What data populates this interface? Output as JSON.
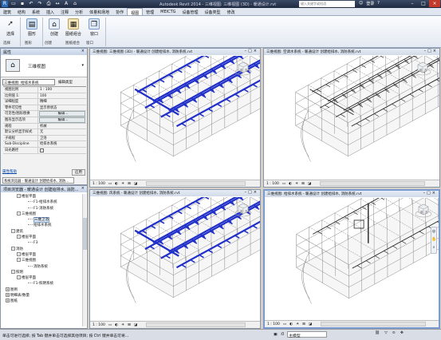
{
  "titlebar": {
    "title": "Autodesk Revit 2014 - 三维视图: 三维视图 (3D) - 暖通设计.rvt",
    "search_placeholder": "键入关键字或短语",
    "user": "登录",
    "help": "?"
  },
  "ribbon_tabs": [
    "建筑",
    "结构",
    "系统",
    "插入",
    "注释",
    "分析",
    "体量和场地",
    "协作",
    "视图",
    "管理",
    "MEICTG",
    "设备管理",
    "设备类型",
    "修改"
  ],
  "active_tab": "视图",
  "ribbon": {
    "buttons": [
      {
        "label": "选择",
        "icon": "select-icon"
      },
      {
        "label": "图形",
        "icon": "graphics-icon"
      },
      {
        "label": "创建",
        "icon": "create-view-icon"
      },
      {
        "label": "图纸组合",
        "icon": "sheet-composition-icon"
      },
      {
        "label": "窗口",
        "icon": "windows-icon"
      }
    ],
    "groups": [
      "选择",
      "图形",
      "创建",
      "图纸组合",
      "窗口"
    ]
  },
  "properties": {
    "title": "属性",
    "type_name": "三维视图",
    "selector": "三维视图: 给排水系统",
    "edit_type": "编辑类型",
    "rows": [
      {
        "k": "视图比例",
        "v": "1 : 100"
      },
      {
        "k": "比例值 1:",
        "v": "100"
      },
      {
        "k": "详细程度",
        "v": "精细"
      },
      {
        "k": "零件可见性",
        "v": "显示原状态"
      },
      {
        "k": "可见性/图形替换",
        "v": "编辑...",
        "btn": true
      },
      {
        "k": "图形显示选项",
        "v": "编辑...",
        "btn": true
      },
      {
        "k": "规程",
        "v": "机械"
      },
      {
        "k": "默认分析显示样式",
        "v": "无"
      },
      {
        "k": "子规程",
        "v": "卫浴"
      },
      {
        "k": "Sub-Discipline",
        "v": "给排水系统"
      },
      {
        "k": "日光路径",
        "v": ""
      }
    ],
    "help_link": "属性帮助",
    "apply": "应用",
    "tab_label": "系统浏览器 - 暖通设计 创建给排水, 消防..."
  },
  "browser": {
    "title": "项目浏览器 - 暖通设计 创建给排水, 消防...",
    "nodes": [
      {
        "label": "楼层平面",
        "depth": 2,
        "box": "-"
      },
      {
        "label": "F1-给排水系统",
        "depth": 4
      },
      {
        "label": "F1-消防系统",
        "depth": 4
      },
      {
        "label": "三维视图",
        "depth": 2,
        "box": "-"
      },
      {
        "label": "三维卫浴",
        "depth": 4,
        "selected": true
      },
      {
        "label": "给排水系统",
        "depth": 4
      },
      {
        "label": "建筑",
        "depth": 1,
        "box": "-"
      },
      {
        "label": "楼层平面",
        "depth": 2,
        "box": "-"
      },
      {
        "label": "F3",
        "depth": 4
      },
      {
        "label": "消防",
        "depth": 1,
        "box": "-"
      },
      {
        "label": "楼层平面",
        "depth": 2,
        "box": "-"
      },
      {
        "label": "三维视图",
        "depth": 2,
        "box": "-"
      },
      {
        "label": "消防系统",
        "depth": 4
      },
      {
        "label": "照明",
        "depth": 1,
        "box": "-"
      },
      {
        "label": "楼层平面",
        "depth": 2,
        "box": "-"
      },
      {
        "label": "F1-照明系统",
        "depth": 4
      },
      {
        "label": "图例",
        "depth": 0,
        "box": "+"
      },
      {
        "label": "明细表/数量",
        "depth": 0,
        "box": "+"
      },
      {
        "label": "图纸",
        "depth": 0,
        "box": "+"
      }
    ]
  },
  "views": [
    {
      "title": "三维视图: 三维视图 (3D) - 暖通设计 创建给排水, 消防系统.rvt",
      "scale": "1 : 100",
      "pipe_color": "#2030c8",
      "style": "blue"
    },
    {
      "title": "三维视图: 空调水系统 - 暖通设计 创建给排水, 消防系统.rvt",
      "scale": "1 : 100",
      "pipe_color": "#222222",
      "style": "black"
    },
    {
      "title": "三维视图: 风系统 - 暖通设计 创建给排水, 消防系统.rvt",
      "scale": "1 : 100",
      "pipe_color": "#2030c8",
      "style": "blue"
    },
    {
      "title": "三维视图: 给排水系统 - 暖通设计 创建给排水, 消防系统.rvt",
      "scale": "1 : 100",
      "pipe_color": "#222222",
      "style": "sparse"
    }
  ],
  "viewcube_labels": {
    "front": "前",
    "right": "右"
  },
  "statusbar": {
    "message": "单击可进行选择; 按 Tab 键并单击可选择其他项目; 按 Ctrl 键并单击可将...",
    "workset": "主模型",
    "zero": ":0"
  },
  "colors": {
    "pipe_blue": "#2030c8",
    "model_line": "#8a8a8a",
    "active_border": "#7a9bd2"
  }
}
